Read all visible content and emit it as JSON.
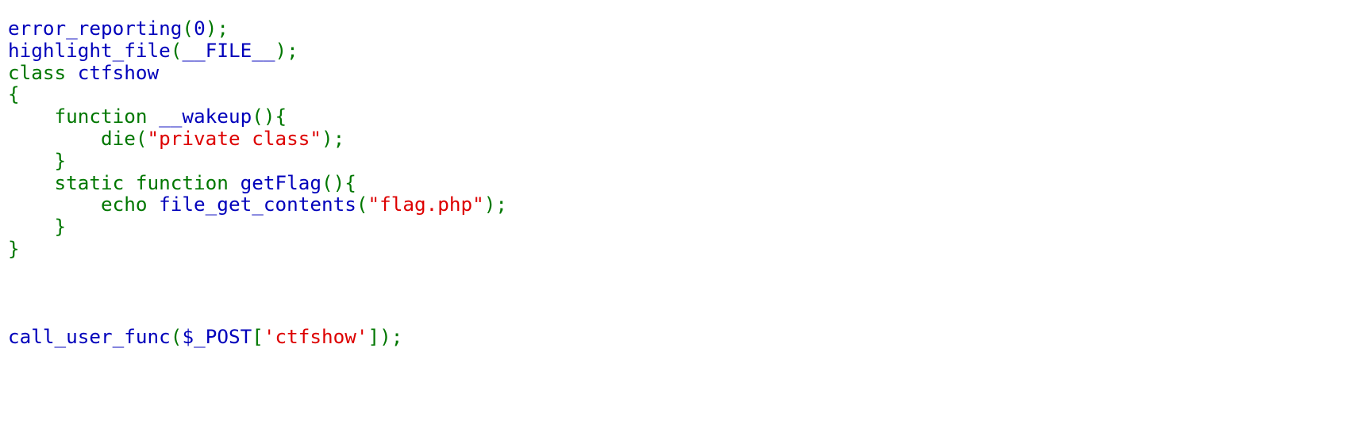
{
  "source": {
    "colors": {
      "default": "#0000BB",
      "keyword": "#007700",
      "string": "#DD0000"
    },
    "lines": [
      {
        "tokens": [
          {
            "kind": "default",
            "text": "error_reporting"
          },
          {
            "kind": "keyword",
            "text": "("
          },
          {
            "kind": "default",
            "text": "0"
          },
          {
            "kind": "keyword",
            "text": ");"
          }
        ]
      },
      {
        "tokens": [
          {
            "kind": "default",
            "text": "highlight_file"
          },
          {
            "kind": "keyword",
            "text": "("
          },
          {
            "kind": "default",
            "text": "__FILE__"
          },
          {
            "kind": "keyword",
            "text": ");"
          }
        ]
      },
      {
        "tokens": [
          {
            "kind": "keyword",
            "text": "class "
          },
          {
            "kind": "default",
            "text": "ctfshow"
          }
        ]
      },
      {
        "tokens": [
          {
            "kind": "keyword",
            "text": "{"
          }
        ]
      },
      {
        "tokens": [
          {
            "kind": "keyword",
            "text": "    function "
          },
          {
            "kind": "default",
            "text": "__wakeup"
          },
          {
            "kind": "keyword",
            "text": "(){"
          }
        ]
      },
      {
        "tokens": [
          {
            "kind": "keyword",
            "text": "        die("
          },
          {
            "kind": "string",
            "text": "\"private class\""
          },
          {
            "kind": "keyword",
            "text": ");"
          }
        ]
      },
      {
        "tokens": [
          {
            "kind": "keyword",
            "text": "    }"
          }
        ]
      },
      {
        "tokens": [
          {
            "kind": "keyword",
            "text": "    static function "
          },
          {
            "kind": "default",
            "text": "getFlag"
          },
          {
            "kind": "keyword",
            "text": "(){"
          }
        ]
      },
      {
        "tokens": [
          {
            "kind": "keyword",
            "text": "        echo "
          },
          {
            "kind": "default",
            "text": "file_get_contents"
          },
          {
            "kind": "keyword",
            "text": "("
          },
          {
            "kind": "string",
            "text": "\"flag.php\""
          },
          {
            "kind": "keyword",
            "text": ");"
          }
        ]
      },
      {
        "tokens": [
          {
            "kind": "keyword",
            "text": "    }"
          }
        ]
      },
      {
        "tokens": [
          {
            "kind": "keyword",
            "text": "}"
          }
        ]
      },
      {
        "tokens": []
      },
      {
        "tokens": []
      },
      {
        "tokens": []
      },
      {
        "tokens": [
          {
            "kind": "default",
            "text": "call_user_func"
          },
          {
            "kind": "keyword",
            "text": "("
          },
          {
            "kind": "default",
            "text": "$_POST"
          },
          {
            "kind": "keyword",
            "text": "["
          },
          {
            "kind": "string",
            "text": "'ctfshow'"
          },
          {
            "kind": "keyword",
            "text": "]);"
          }
        ]
      }
    ]
  }
}
